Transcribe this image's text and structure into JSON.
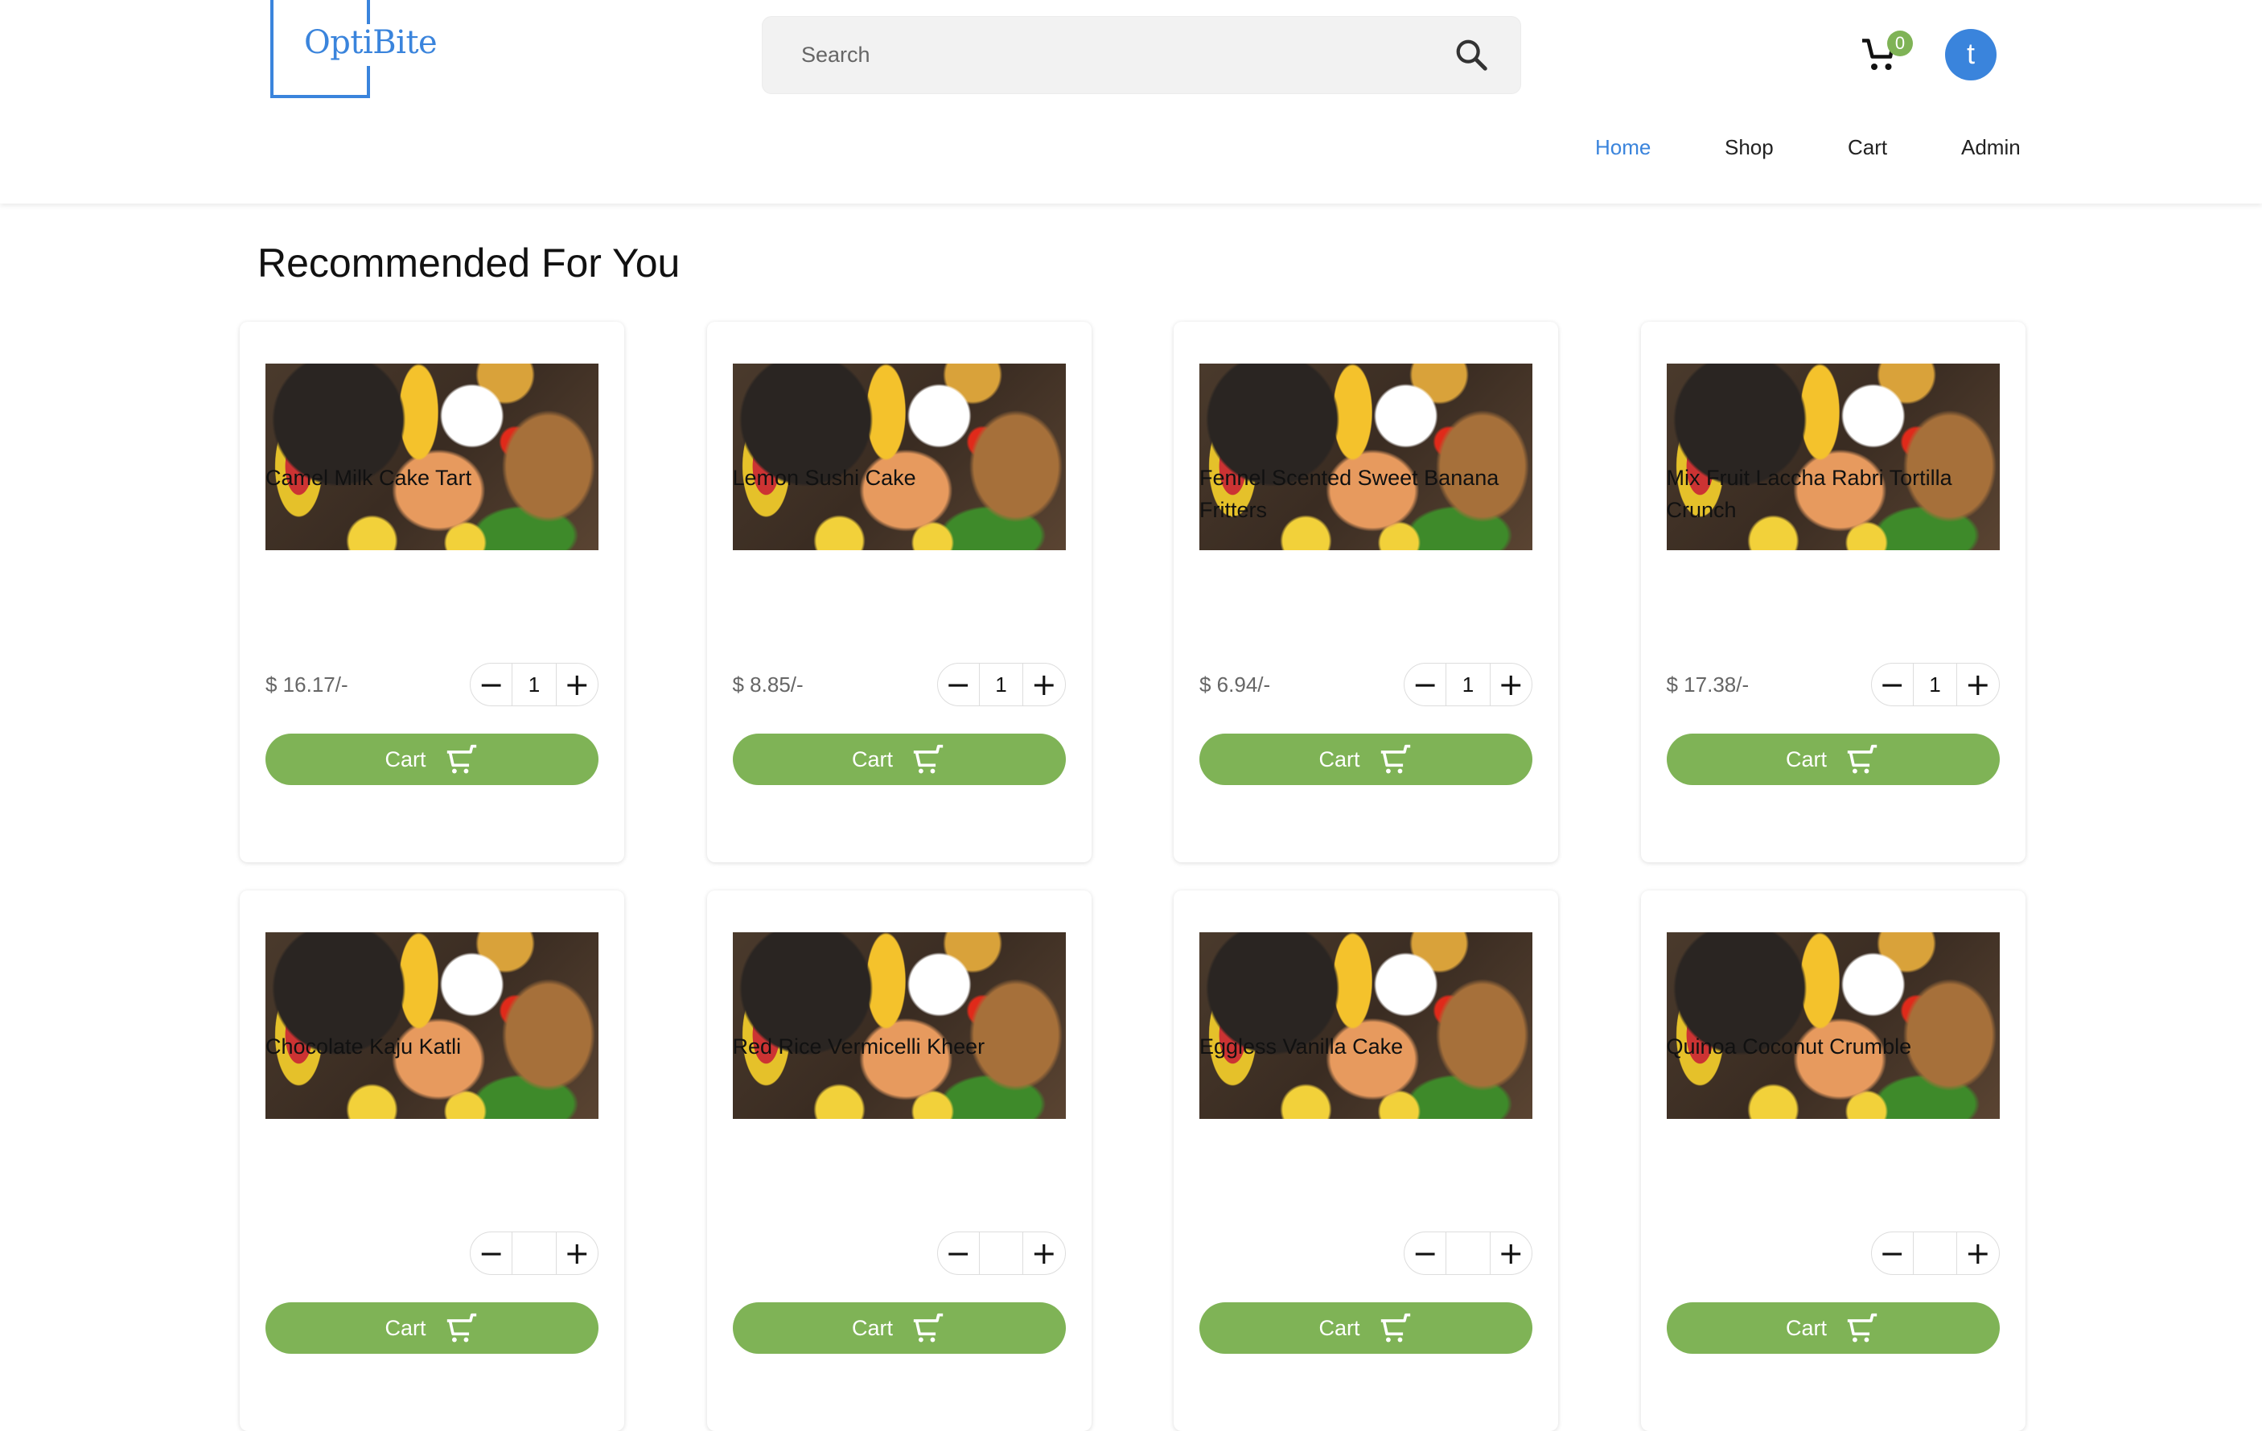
{
  "header": {
    "logo_text": "OptiBite",
    "search_placeholder": "Search",
    "cart_count": "0",
    "avatar_initial": "t",
    "nav": [
      {
        "label": "Home",
        "active": true
      },
      {
        "label": "Shop",
        "active": false
      },
      {
        "label": "Cart",
        "active": false
      },
      {
        "label": "Admin",
        "active": false
      }
    ]
  },
  "main": {
    "title": "Recommended For You",
    "add_to_cart_label": "Cart",
    "products": [
      {
        "name": "Camel Milk Cake Tart",
        "price": "$ 16.17/-",
        "qty": "1"
      },
      {
        "name": "Lemon Sushi Cake",
        "price": "$ 8.85/-",
        "qty": "1"
      },
      {
        "name": "Fennel Scented Sweet Banana Fritters",
        "price": "$ 6.94/-",
        "qty": "1"
      },
      {
        "name": "Mix Fruit Laccha Rabri Tortilla Crunch",
        "price": "$ 17.38/-",
        "qty": "1"
      },
      {
        "name": "Chocolate Kaju Katli",
        "price": null,
        "qty": null
      },
      {
        "name": "Red Rice Vermicelli Kheer",
        "price": null,
        "qty": null
      },
      {
        "name": "Eggless Vanilla Cake",
        "price": null,
        "qty": null
      },
      {
        "name": "Quinoa Coconut Crumble",
        "price": null,
        "qty": null
      }
    ]
  },
  "colors": {
    "accent": "#3a84dc",
    "green": "#7fb356"
  }
}
